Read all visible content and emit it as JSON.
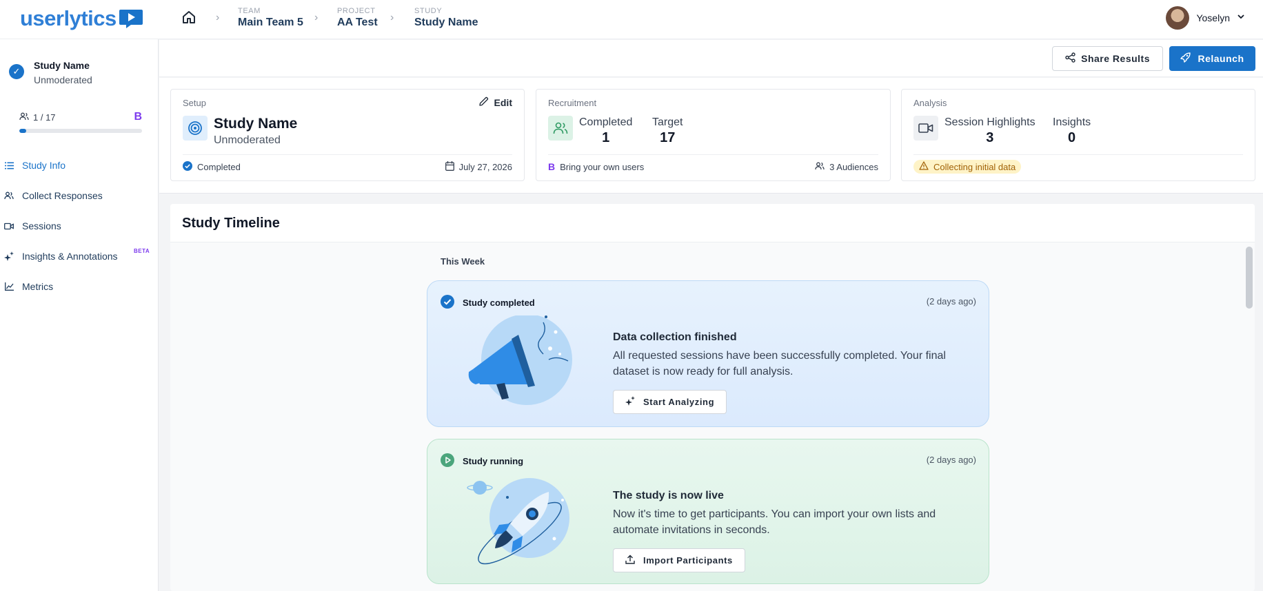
{
  "app": {
    "logo_text": "userlytics"
  },
  "breadcrumb": [
    {
      "key": "TEAM",
      "value": "Main Team 5"
    },
    {
      "key": "PROJECT",
      "value": "AA Test"
    },
    {
      "key": "STUDY",
      "value": "Study Name"
    }
  ],
  "user": {
    "name": "Yoselyn"
  },
  "sidebar": {
    "study_title": "Study Name",
    "study_type": "Unmoderated",
    "progress_text": "1 / 17",
    "progress_completed": 1,
    "progress_target": 17,
    "badge": "B",
    "nav": [
      {
        "label": "Study Info",
        "icon": "list-icon",
        "active": true
      },
      {
        "label": "Collect Responses",
        "icon": "users-icon"
      },
      {
        "label": "Sessions",
        "icon": "video-icon"
      },
      {
        "label": "Insights & Annotations",
        "icon": "sparkle-icon",
        "badge": "BETA"
      },
      {
        "label": "Metrics",
        "icon": "chart-icon"
      }
    ]
  },
  "actions": {
    "share": "Share Results",
    "relaunch": "Relaunch"
  },
  "setup": {
    "label": "Setup",
    "edit": "Edit",
    "title": "Study Name",
    "type": "Unmoderated",
    "status": "Completed",
    "date": "July 27, 2026"
  },
  "recruitment": {
    "label": "Recruitment",
    "completed_label": "Completed",
    "completed_value": "1",
    "target_label": "Target",
    "target_value": "17",
    "badge": "B",
    "source": "Bring your own users",
    "audiences": "3 Audiences"
  },
  "analysis": {
    "label": "Analysis",
    "highlights_label": "Session Highlights",
    "highlights_value": "3",
    "insights_label": "Insights",
    "insights_value": "0",
    "status": "Collecting initial data"
  },
  "timeline": {
    "title": "Study Timeline",
    "week": "This Week",
    "events": [
      {
        "head": "Study completed",
        "time": "(2 days ago)",
        "title": "Data collection finished",
        "body": "All requested sessions have been successfully completed. Your final dataset is now ready for full analysis.",
        "button": "Start Analyzing"
      },
      {
        "head": "Study running",
        "time": "(2 days ago)",
        "title": "The study is now live",
        "body": "Now it's time to get participants. You can import your own lists and automate invitations in seconds.",
        "button": "Import Participants"
      }
    ]
  },
  "colors": {
    "accent": "#1a73c9",
    "purple": "#7c3aed",
    "warn_bg": "#fef3c7",
    "warn_text": "#a16207"
  }
}
